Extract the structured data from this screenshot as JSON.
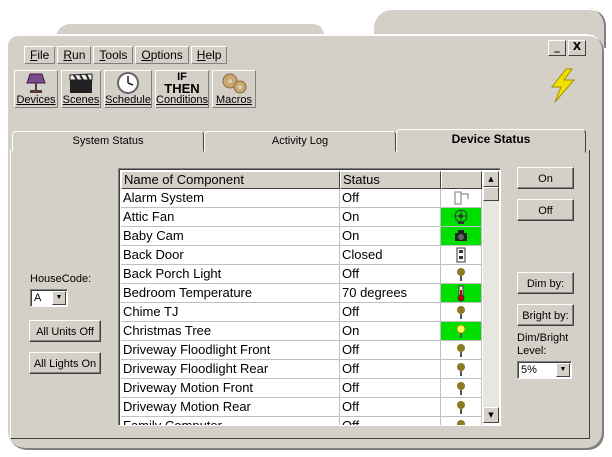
{
  "menubar": [
    {
      "pre": "",
      "u": "F",
      "post": "ile"
    },
    {
      "pre": "",
      "u": "R",
      "post": "un"
    },
    {
      "pre": "",
      "u": "T",
      "post": "ools"
    },
    {
      "pre": "",
      "u": "O",
      "post": "ptions"
    },
    {
      "pre": "",
      "u": "H",
      "post": "elp"
    }
  ],
  "window_buttons": {
    "minimize": "_",
    "close": "X"
  },
  "toolbar": [
    {
      "label": "Devices",
      "icon": "lamp-icon"
    },
    {
      "label": "Scenes",
      "icon": "clapperboard-icon"
    },
    {
      "label": "Schedule",
      "icon": "clock-icon"
    },
    {
      "label": "Conditions",
      "icon": "if-then-icon",
      "icon_text": [
        "IF",
        "THEN"
      ]
    },
    {
      "label": "Macros",
      "icon": "gears-icon"
    }
  ],
  "tabs": {
    "system_status": "System Status",
    "activity_log": "Activity Log",
    "device_status": "Device Status",
    "active": "device_status"
  },
  "left": {
    "housecode_label": "HouseCode:",
    "housecode_value": "A",
    "all_units_off": "All Units Off",
    "all_lights_on": "All Lights On"
  },
  "right": {
    "on": "On",
    "off": "Off",
    "dim_by": "Dim by:",
    "bright_by": "Bright by:",
    "level_label_1": "Dim/Bright",
    "level_label_2": "Level:",
    "level_value": "5%"
  },
  "grid": {
    "headers": [
      "Name of Component",
      "Status",
      ""
    ],
    "rows": [
      {
        "name": "Alarm System",
        "status": "Off",
        "icon": "alarm-icon",
        "on": false
      },
      {
        "name": "Attic Fan",
        "status": "On",
        "icon": "fan-icon",
        "on": true
      },
      {
        "name": "Baby Cam",
        "status": "On",
        "icon": "camera-icon",
        "on": true
      },
      {
        "name": "Back Door",
        "status": "Closed",
        "icon": "door-sensor-icon",
        "on": false
      },
      {
        "name": "Back Porch Light",
        "status": "Off",
        "icon": "bulb-icon",
        "on": false
      },
      {
        "name": "Bedroom Temperature",
        "status": "70 degrees",
        "icon": "thermometer-icon",
        "on": true
      },
      {
        "name": "Chime TJ",
        "status": "Off",
        "icon": "bulb-icon",
        "on": false
      },
      {
        "name": "Christmas Tree",
        "status": "On",
        "icon": "bulb-icon",
        "on": true
      },
      {
        "name": "Driveway Floodlight Front",
        "status": "Off",
        "icon": "bulb-icon",
        "on": false
      },
      {
        "name": "Driveway Floodlight Rear",
        "status": "Off",
        "icon": "bulb-icon",
        "on": false
      },
      {
        "name": "Driveway Motion Front",
        "status": "Off",
        "icon": "bulb-icon",
        "on": false
      },
      {
        "name": "Driveway Motion Rear",
        "status": "Off",
        "icon": "bulb-icon",
        "on": false
      },
      {
        "name": "Family Computer",
        "status": "Off",
        "icon": "bulb-icon",
        "on": false
      }
    ]
  },
  "colors": {
    "face": "#d4d0c8",
    "on_green": "#00e000",
    "bolt": "#f2e000"
  }
}
